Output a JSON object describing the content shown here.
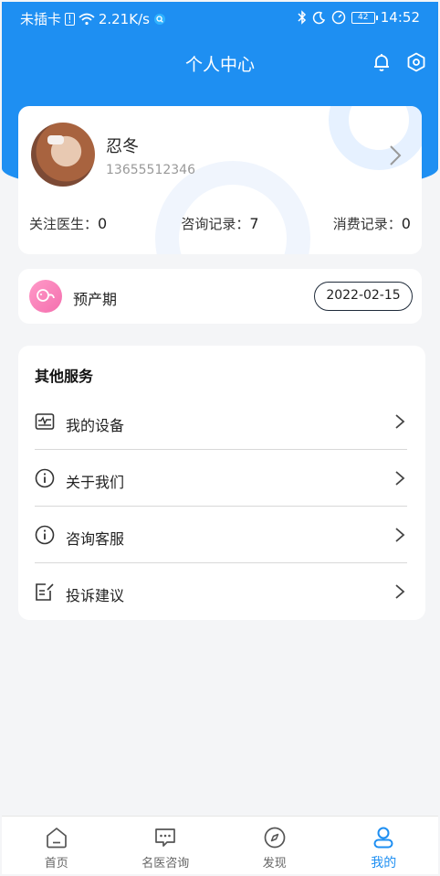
{
  "status_bar": {
    "carrier": "未插卡",
    "speed": "2.21K/s",
    "battery": "42",
    "time": "14:52"
  },
  "header": {
    "title": "个人中心"
  },
  "profile": {
    "name": "忍冬",
    "phone": "13655512346",
    "stats": [
      {
        "label": "关注医生：",
        "value": "0"
      },
      {
        "label": "咨询记录：",
        "value": "7"
      },
      {
        "label": "消费记录：",
        "value": "0"
      }
    ]
  },
  "due_date": {
    "label": "预产期",
    "date": "2022-02-15"
  },
  "services": {
    "title": "其他服务",
    "items": [
      {
        "label": "我的设备",
        "icon": "device-icon"
      },
      {
        "label": "关于我们",
        "icon": "info-icon"
      },
      {
        "label": "咨询客服",
        "icon": "info-icon"
      },
      {
        "label": "投诉建议",
        "icon": "feedback-icon"
      }
    ]
  },
  "tabbar": {
    "tabs": [
      {
        "label": "首页",
        "icon": "home-icon"
      },
      {
        "label": "名医咨询",
        "icon": "chat-icon"
      },
      {
        "label": "发现",
        "icon": "compass-icon"
      },
      {
        "label": "我的",
        "icon": "user-icon"
      }
    ],
    "active_index": 3
  },
  "colors": {
    "primary": "#1e8ff2",
    "background": "#f4f5f7",
    "pink_accent": "#f46fae"
  }
}
